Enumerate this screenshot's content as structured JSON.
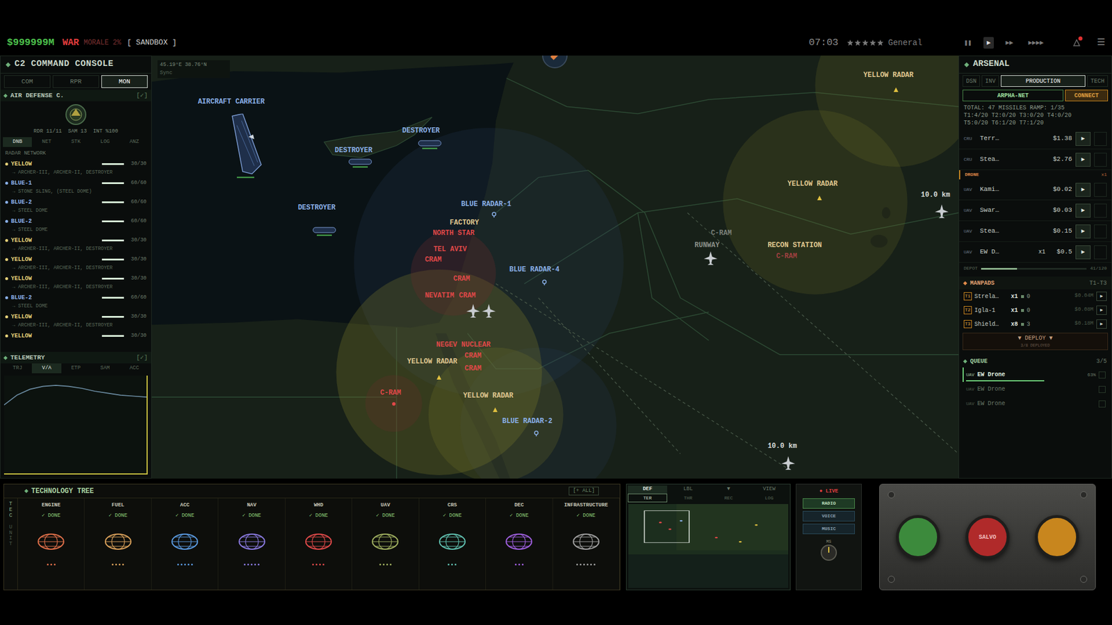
{
  "top_bar": {
    "money": "$999999M",
    "mode": "WAR",
    "morale": "MORALE 2%",
    "sandbox": "[ SANDBOX ]",
    "time": "07:03",
    "stars": 5,
    "rank": "General",
    "speed_buttons": [
      {
        "label": "❚❚",
        "selected": false
      },
      {
        "label": "▶",
        "selected": true
      },
      {
        "label": "▶▶",
        "selected": false
      },
      {
        "label": "▶▶▶▶",
        "selected": false
      }
    ],
    "menu": "☰"
  },
  "command_console": {
    "title": "C2 COMMAND CONSOLE",
    "tabs": [
      {
        "label": "COM",
        "selected": false
      },
      {
        "label": "RPR",
        "selected": false
      },
      {
        "label": "MON",
        "selected": true
      }
    ],
    "air_defense": {
      "title": "AIR DEFENSE C.",
      "toggle": "[✓]",
      "stats": "RDR 11/11  SAM 13  INT %100",
      "subtabs": [
        {
          "label": "DNB",
          "selected": true
        },
        {
          "label": "NET",
          "selected": false
        },
        {
          "label": "STK",
          "selected": false
        },
        {
          "label": "LOG",
          "selected": false
        },
        {
          "label": "ANZ",
          "selected": false
        }
      ],
      "network_title": "RADAR NETWORK",
      "radars": [
        {
          "name": "YELLOW",
          "reading": "30/30",
          "level": 1,
          "sub": "→ ARCHER-III, ARCHER-II, DESTROYER",
          "color": "#e6d27a"
        },
        {
          "name": "BLUE-1",
          "reading": "60/60",
          "level": 1,
          "sub": "→ STONE SLING, (STEEL DOME)",
          "color": "#8ab0e8"
        },
        {
          "name": "BLUE-2",
          "reading": "60/60",
          "level": 1,
          "sub": "→ STEEL DOME",
          "color": "#8ab0e8"
        },
        {
          "name": "BLUE-2",
          "reading": "60/60",
          "level": 1,
          "sub": "→ STEEL DOME",
          "color": "#8ab0e8"
        },
        {
          "name": "YELLOW",
          "reading": "30/30",
          "level": 1,
          "sub": "→ ARCHER-III, ARCHER-II, DESTROYER",
          "color": "#e6d27a"
        },
        {
          "name": "YELLOW",
          "reading": "30/30",
          "level": 1,
          "sub": "→ ARCHER-III, ARCHER-II, DESTROYER",
          "color": "#e6d27a"
        },
        {
          "name": "YELLOW",
          "reading": "30/30",
          "level": 1,
          "sub": "→ ARCHER-III, ARCHER-II, DESTROYER",
          "color": "#e6d27a"
        },
        {
          "name": "BLUE-2",
          "reading": "60/60",
          "level": 1,
          "sub": "→ STEEL DOME",
          "color": "#8ab0e8"
        },
        {
          "name": "YELLOW",
          "reading": "30/30",
          "level": 1,
          "sub": "→ ARCHER-III, ARCHER-II, DESTROYER",
          "color": "#e6d27a"
        },
        {
          "name": "YELLOW",
          "reading": "30/30",
          "level": 1,
          "color": "#e6d27a"
        }
      ]
    },
    "telemetry": {
      "title": "TELEMETRY",
      "toggle": "[✓]",
      "tabs": [
        {
          "label": "TRJ",
          "selected": false
        },
        {
          "label": "V/A",
          "selected": true
        },
        {
          "label": "ETP",
          "selected": false
        },
        {
          "label": "SAM",
          "selected": false
        },
        {
          "label": "ACC",
          "selected": false
        }
      ],
      "chart": {
        "values": [
          70,
          80,
          86,
          89,
          90,
          89,
          87,
          84,
          82,
          80,
          79,
          78
        ]
      }
    }
  },
  "map": {
    "coords": "45.19°E 38.76°N",
    "sync": "Sync",
    "labels": [
      {
        "text": "AIRCRAFT CARRIER",
        "color": "#8ab0e8"
      },
      {
        "text": "DESTROYER",
        "color": "#8ab0e8"
      },
      {
        "text": "DESTROYER",
        "color": "#8ab0e8"
      },
      {
        "text": "DESTROYER",
        "color": "#8ab0e8"
      },
      {
        "text": "BLUE RADAR-1",
        "color": "#8ab0e8"
      },
      {
        "text": "FACTORY",
        "color": "#e0c890"
      },
      {
        "text": "NORTH STAR",
        "color": "#e04848"
      },
      {
        "text": "TEL AVIV",
        "color": "#e04848"
      },
      {
        "text": "CRAM",
        "color": "#e04848"
      },
      {
        "text": "CRAM",
        "color": "#e04848"
      },
      {
        "text": "BLUE RADAR-4",
        "color": "#8ab0e8"
      },
      {
        "text": "NEVATIM",
        "color": "#e04848"
      },
      {
        "text": "CRAM",
        "color": "#e04848"
      },
      {
        "text": "NEGEV NUCLEAR",
        "color": "#e04848"
      },
      {
        "text": "CRAM",
        "color": "#e04848"
      },
      {
        "text": "YELLOW RADAR",
        "color": "#e0c890"
      },
      {
        "text": "CRAM",
        "color": "#e04848"
      },
      {
        "text": "C-RAM",
        "color": "#e04848"
      },
      {
        "text": "YELLOW RADAR",
        "color": "#e0c890"
      },
      {
        "text": "BLUE RADAR-2",
        "color": "#8ab0e8"
      },
      {
        "text": "C-RAM",
        "color": "#7a7f78"
      },
      {
        "text": "RUNWAY",
        "color": "#8a8f88"
      },
      {
        "text": "RECON STATION",
        "color": "#e0c890"
      },
      {
        "text": "C-RAM",
        "color": "#a04040"
      },
      {
        "text": "YELLOW RADAR",
        "color": "#e0c890"
      },
      {
        "text": "YELLOW RADAR",
        "color": "#e0c890"
      },
      {
        "text": "10.0 km",
        "color": "#d8dcd8"
      },
      {
        "text": "10.0 km",
        "color": "#d8dcd8"
      }
    ]
  },
  "arsenal": {
    "title": "ARSENAL",
    "tabs": [
      {
        "label": "DSN",
        "selected": false
      },
      {
        "label": "INV",
        "selected": false
      },
      {
        "label": "PRODUCTION",
        "selected": true
      },
      {
        "label": "TECH",
        "selected": false
      }
    ],
    "network": "ARPHA-NET",
    "connect": "CONNECT",
    "info": [
      "TOTAL: 47 MISSILES RAMP: 1/35",
      "T1:4/20 T2:0/20 T3:0/20 T4:0/20",
      "T5:0/20 T6:1/20 T7:1/20"
    ],
    "cruise": [
      {
        "tag": "CRU",
        "name": "Terr…",
        "price": "$1.38",
        "play": "▶"
      },
      {
        "tag": "CRU",
        "name": "Stea…",
        "price": "$2.76",
        "play": "▶"
      }
    ],
    "drone_header": {
      "title": "DRONE",
      "count": "x1"
    },
    "drones": [
      {
        "tag": "UAV",
        "name": "Kami…",
        "price": "$0.02",
        "play": "▶"
      },
      {
        "tag": "UAV",
        "name": "Swar…",
        "price": "$0.03",
        "play": "▶"
      },
      {
        "tag": "UAV",
        "name": "Stea…",
        "price": "$0.15",
        "play": "▶"
      },
      {
        "tag": "UAV",
        "name": "EW D…",
        "count": "x1",
        "price": "$0.5",
        "play": "▶"
      }
    ],
    "depot": {
      "label": "DEPOT",
      "reading": "41/120",
      "level": 0.34
    },
    "manpads": {
      "title": "MANPADS",
      "range": "T1-T3",
      "items": [
        {
          "tier": "T1",
          "name": "Strela…",
          "count": "x1",
          "stock": "0",
          "price": "$0.04M",
          "play": "▶"
        },
        {
          "tier": "T2",
          "name": "Igla-1",
          "count": "x1",
          "stock": "0",
          "price": "$0.08M",
          "play": "▶"
        },
        {
          "tier": "T3",
          "name": "Shield…",
          "count": "x8",
          "stock": "3",
          "price": "$0.18M",
          "play": "▶"
        }
      ]
    },
    "deploy": {
      "label": "▼ DEPLOY ▼",
      "sub": "3/8 DEPLOYED"
    },
    "queue": {
      "title": "QUEUE",
      "count": "3/5",
      "items": [
        {
          "tag": "UAV",
          "name": "EW Drone",
          "level": 0.63,
          "reading": "63%",
          "active": true
        },
        {
          "tag": "UAV",
          "name": "EW Drone",
          "level": 0,
          "active": false
        },
        {
          "tag": "UAV",
          "name": "EW Drone",
          "level": 0,
          "active": false
        }
      ]
    }
  },
  "tech_tree": {
    "title": "TECHNOLOGY TREE",
    "all_button": "[+ ALL]",
    "side_tabs": [
      {
        "label": "TEC",
        "selected": true
      },
      {
        "label": "UNIT",
        "selected": false
      }
    ],
    "columns": [
      {
        "name": "ENGINE",
        "status": "✓ DONE",
        "stars": 3,
        "color": "#e0704a"
      },
      {
        "name": "FUEL",
        "status": "✓ DONE",
        "stars": 4,
        "color": "#d9a05a"
      },
      {
        "name": "ACC",
        "status": "✓ DONE",
        "stars": 5,
        "color": "#5a9ae0"
      },
      {
        "name": "NAV",
        "status": "✓ DONE",
        "stars": 5,
        "color": "#8a7ae0"
      },
      {
        "name": "WHD",
        "status": "✓ DONE",
        "stars": 4,
        "color": "#e04a4a"
      },
      {
        "name": "UAV",
        "status": "✓ DONE",
        "stars": 4,
        "color": "#a0b060"
      },
      {
        "name": "CRS",
        "status": "✓ DONE",
        "stars": 3,
        "color": "#60c0b0"
      },
      {
        "name": "DEC",
        "status": "✓ DONE",
        "stars": 3,
        "color": "#a060e0"
      },
      {
        "name": "INFRASTRUCTURE",
        "status": "✓ DONE",
        "stars": 6,
        "color": "#a0a0a0"
      }
    ]
  },
  "minimap": {
    "tabs_top": [
      {
        "label": "DEF",
        "selected": true
      },
      {
        "label": "LBL",
        "selected": false
      },
      {
        "label": "▼",
        "selected": false
      },
      {
        "label": "VIEW",
        "selected": false
      }
    ],
    "tabs_bottom": [
      {
        "label": "TER",
        "selected": true
      },
      {
        "label": "THR",
        "selected": false
      },
      {
        "label": "REC",
        "selected": false
      },
      {
        "label": "LOG",
        "selected": false
      }
    ]
  },
  "radio": {
    "live": "● LIVE",
    "buttons": [
      {
        "label": "RADIO",
        "selected": true
      },
      {
        "label": "VOICE",
        "selected": false
      },
      {
        "label": "MUSIC",
        "selected": false
      }
    ],
    "knob": "MS"
  },
  "launch_panel": {
    "buttons": [
      {
        "color": "#3c8a3c"
      },
      {
        "label": "SALVO",
        "color": "#b02a2a"
      },
      {
        "color": "#c8861e"
      }
    ]
  }
}
